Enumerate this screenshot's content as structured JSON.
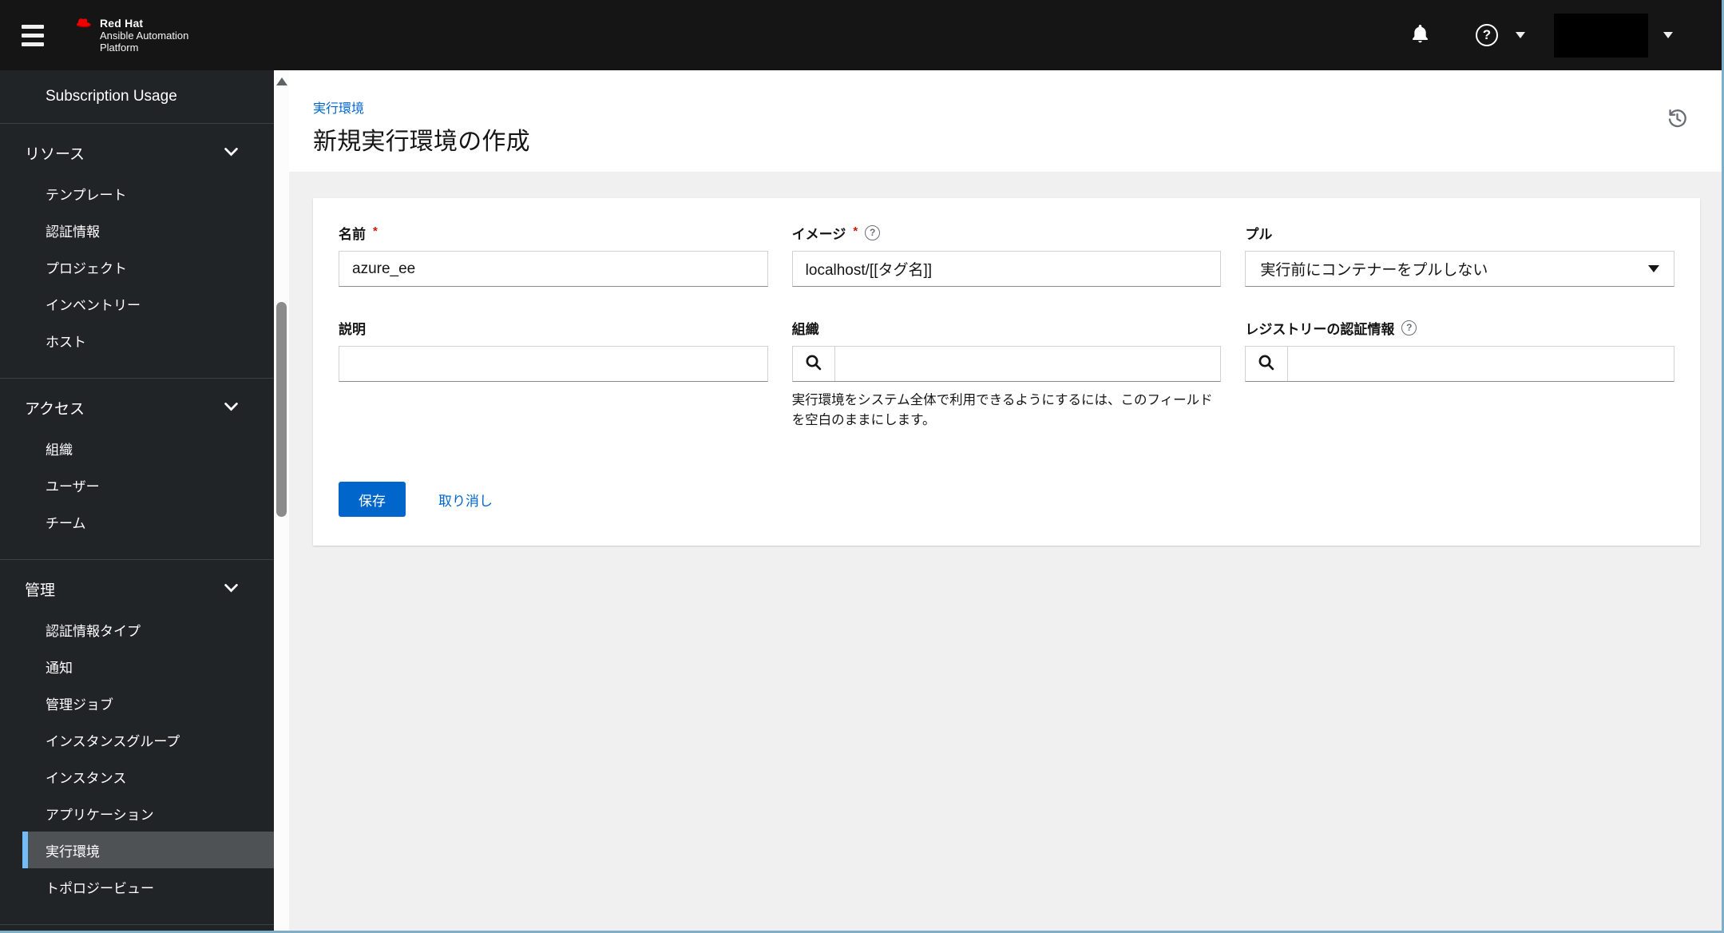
{
  "masthead": {
    "brand": {
      "name": "Red Hat",
      "product_line1": "Ansible Automation",
      "product_line2": "Platform"
    },
    "icons": {
      "notifications": "bell-icon",
      "help": "question-circle-icon",
      "user_menu": "caret-down-icon"
    }
  },
  "sidebar": {
    "standalone_item": "Subscription Usage",
    "sections": [
      {
        "title": "リソース",
        "items": [
          "テンプレート",
          "認証情報",
          "プロジェクト",
          "インベントリー",
          "ホスト"
        ]
      },
      {
        "title": "アクセス",
        "items": [
          "組織",
          "ユーザー",
          "チーム"
        ]
      },
      {
        "title": "管理",
        "items": [
          "認証情報タイプ",
          "通知",
          "管理ジョブ",
          "インスタンスグループ",
          "インスタンス",
          "アプリケーション",
          "実行環境",
          "トポロジービュー"
        ],
        "active_item": "実行環境"
      }
    ]
  },
  "page": {
    "breadcrumb": "実行環境",
    "title": "新規実行環境の作成"
  },
  "form": {
    "name": {
      "label": "名前",
      "required": "*",
      "value": "azure_ee"
    },
    "image": {
      "label": "イメージ",
      "required": "*",
      "value": "localhost/[[タグ名]]"
    },
    "pull": {
      "label": "プル",
      "selected": "実行前にコンテナーをプルしない"
    },
    "description": {
      "label": "説明",
      "value": ""
    },
    "organization": {
      "label": "組織",
      "value": "",
      "helper_text": "実行環境をシステム全体で利用できるようにするには、このフィールドを空白のままにします。"
    },
    "registry_credential": {
      "label": "レジストリーの認証情報",
      "value": ""
    },
    "save_label": "保存",
    "cancel_label": "取り消し"
  },
  "colors": {
    "primary": "#0066cc",
    "masthead_bg": "#151515",
    "sidebar_bg": "#212427",
    "active_nav_bg": "#4f5255",
    "active_nav_indicator": "#73bcf7",
    "required_asterisk": "#c9190b",
    "content_bg": "#f0f0f0"
  }
}
